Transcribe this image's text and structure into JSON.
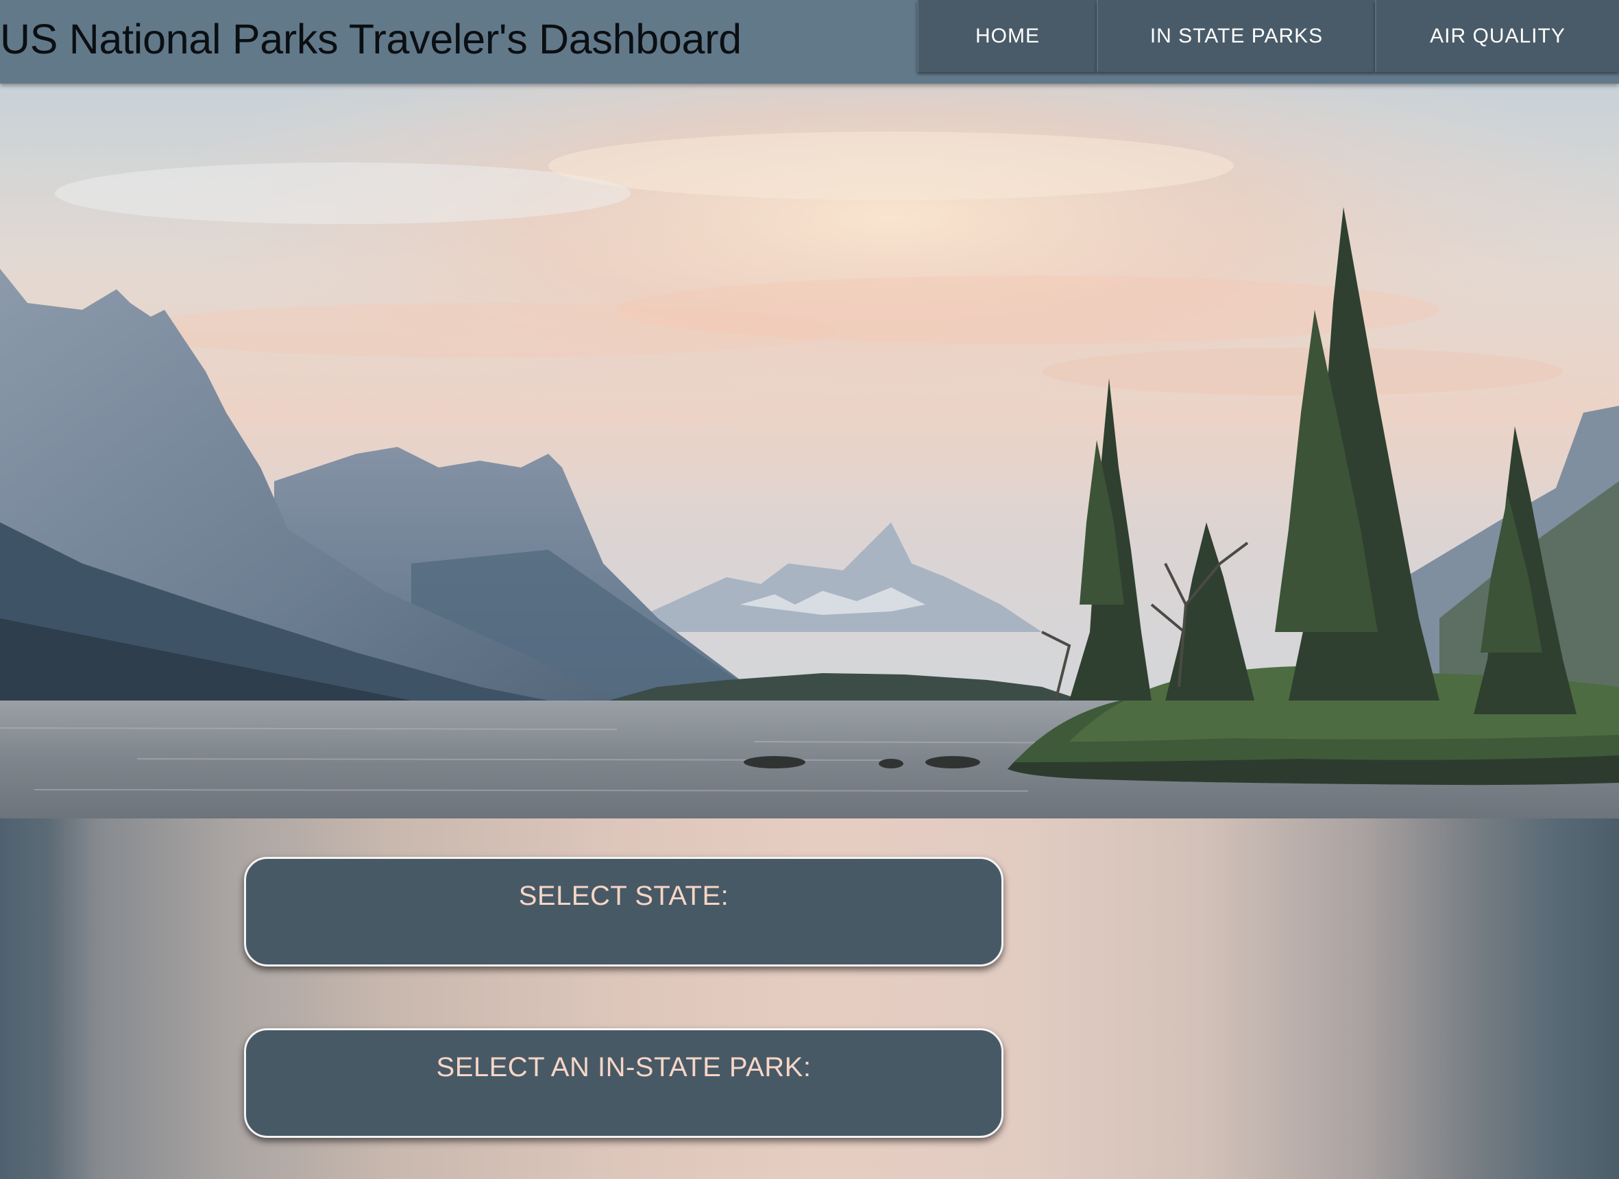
{
  "header": {
    "title": "US National Parks Traveler's Dashboard",
    "background_color": "#62798a"
  },
  "nav": {
    "items": [
      {
        "label": "HOME"
      },
      {
        "label": "IN STATE PARKS"
      },
      {
        "label": "AIR QUALITY"
      }
    ],
    "background_color": "#495b68"
  },
  "hero": {
    "subject": "mountain lake landscape with forested island at sunset"
  },
  "selects": {
    "state": {
      "label": "SELECT STATE:"
    },
    "park": {
      "label": "SELECT AN IN-STATE PARK:"
    },
    "background_color": "#485966",
    "label_color": "#f6d6c6"
  }
}
